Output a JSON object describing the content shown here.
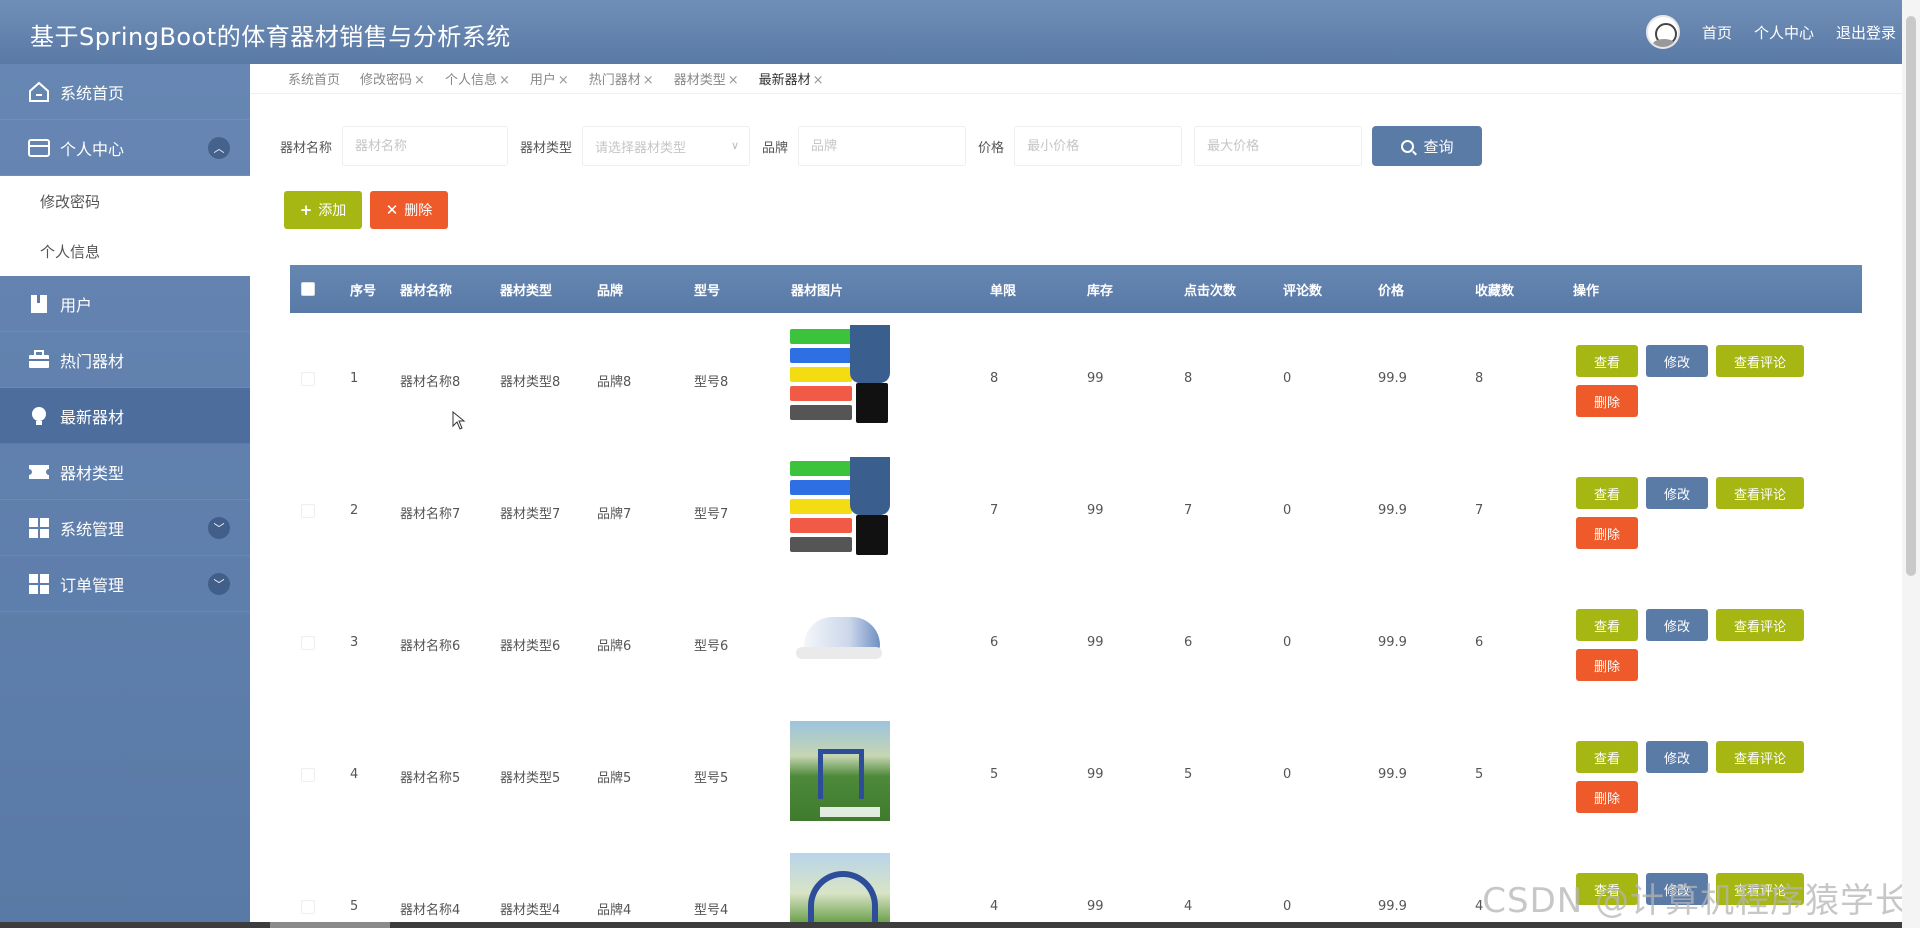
{
  "header": {
    "title": "基于SpringBoot的体育器材销售与分析系统",
    "links": [
      "首页",
      "个人中心",
      "退出登录"
    ]
  },
  "sidebar": {
    "items": [
      {
        "label": "系统首页",
        "icon": "home-icon"
      },
      {
        "label": "个人中心",
        "icon": "card-icon",
        "expanded": true,
        "children": [
          "修改密码",
          "个人信息"
        ]
      },
      {
        "label": "用户",
        "icon": "book-icon"
      },
      {
        "label": "热门器材",
        "icon": "briefcase-icon"
      },
      {
        "label": "最新器材",
        "icon": "bulb-icon",
        "active": true
      },
      {
        "label": "器材类型",
        "icon": "ticket-icon"
      },
      {
        "label": "系统管理",
        "icon": "grid-icon",
        "collapsible": true
      },
      {
        "label": "订单管理",
        "icon": "grid-icon",
        "collapsible": true
      }
    ]
  },
  "tabs": [
    {
      "label": "系统首页",
      "closable": false
    },
    {
      "label": "修改密码",
      "closable": true
    },
    {
      "label": "个人信息",
      "closable": true
    },
    {
      "label": "用户",
      "closable": true
    },
    {
      "label": "热门器材",
      "closable": true
    },
    {
      "label": "器材类型",
      "closable": true
    },
    {
      "label": "最新器材",
      "closable": true,
      "active": true
    }
  ],
  "tab_close_glyph": "×",
  "search": {
    "name_label": "器材名称",
    "name_placeholder": "器材名称",
    "type_label": "器材类型",
    "type_placeholder": "请选择器材类型",
    "brand_label": "品牌",
    "brand_placeholder": "品牌",
    "price_label": "价格",
    "min_price_placeholder": "最小价格",
    "max_price_placeholder": "最大价格",
    "query_label": "查询"
  },
  "actions": {
    "add_label": "添加",
    "delete_label": "删除"
  },
  "table": {
    "columns": [
      "序号",
      "器材名称",
      "器材类型",
      "品牌",
      "型号",
      "器材图片",
      "单限",
      "库存",
      "点击次数",
      "评论数",
      "价格",
      "收藏数",
      "操作"
    ],
    "row_actions": {
      "view": "查看",
      "edit": "修改",
      "comments": "查看评论",
      "delete": "删除"
    },
    "rows": [
      {
        "index": "1",
        "name": "器材名称8",
        "type": "器材类型8",
        "brand": "品牌8",
        "model": "型号8",
        "image": "resistance-bands",
        "limit": "8",
        "stock": "99",
        "clicks": "8",
        "comments": "0",
        "price": "99.9",
        "favorites": "8"
      },
      {
        "index": "2",
        "name": "器材名称7",
        "type": "器材类型7",
        "brand": "品牌7",
        "model": "型号7",
        "image": "resistance-bands",
        "limit": "7",
        "stock": "99",
        "clicks": "7",
        "comments": "0",
        "price": "99.9",
        "favorites": "7"
      },
      {
        "index": "3",
        "name": "器材名称6",
        "type": "器材类型6",
        "brand": "品牌6",
        "model": "型号6",
        "image": "running-shoe",
        "limit": "6",
        "stock": "99",
        "clicks": "6",
        "comments": "0",
        "price": "99.9",
        "favorites": "6"
      },
      {
        "index": "4",
        "name": "器材名称5",
        "type": "器材类型5",
        "brand": "品牌5",
        "model": "型号5",
        "image": "outdoor-fitness-machine",
        "limit": "5",
        "stock": "99",
        "clicks": "5",
        "comments": "0",
        "price": "99.9",
        "favorites": "5"
      },
      {
        "index": "5",
        "name": "器材名称4",
        "type": "器材类型4",
        "brand": "品牌4",
        "model": "型号4",
        "image": "outdoor-fitness-arch",
        "limit": "4",
        "stock": "99",
        "clicks": "4",
        "comments": "0",
        "price": "99.9",
        "favorites": "4"
      }
    ]
  },
  "watermark": "CSDN @计算机程序猿学长",
  "colors": {
    "header": "#5a7aa6",
    "olive_button": "#a6b714",
    "orange_button": "#ee5a2a",
    "blue_button": "#5b7ba7"
  }
}
